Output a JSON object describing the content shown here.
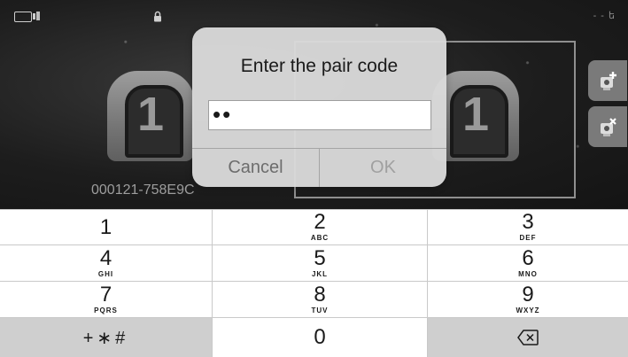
{
  "dialog": {
    "title": "Enter the pair code",
    "input_value": "••",
    "cancel_label": "Cancel",
    "ok_label": "OK"
  },
  "camera": {
    "badge_left": "1",
    "badge_right": "1",
    "id": "000121-758E9C"
  },
  "keypad": {
    "keys": [
      {
        "digit": "1",
        "letters": ""
      },
      {
        "digit": "2",
        "letters": "ABC"
      },
      {
        "digit": "3",
        "letters": "DEF"
      },
      {
        "digit": "4",
        "letters": "GHI"
      },
      {
        "digit": "5",
        "letters": "JKL"
      },
      {
        "digit": "6",
        "letters": "MNO"
      },
      {
        "digit": "7",
        "letters": "PQRS"
      },
      {
        "digit": "8",
        "letters": "TUV"
      },
      {
        "digit": "9",
        "letters": "WXYZ"
      },
      {
        "digit": "0",
        "letters": ""
      }
    ],
    "symbols_label": "+∗#",
    "backspace_icon": "backspace-icon"
  },
  "status": {
    "right_text": "- - ե"
  },
  "colors": {
    "dark_bg": "#1d1d1d",
    "dialog_bg": "#dadada",
    "keypad_bg": "#c9c9c9"
  }
}
